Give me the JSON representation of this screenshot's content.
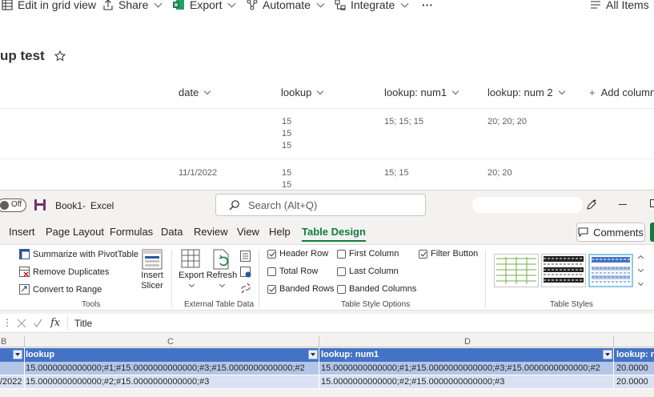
{
  "sharepoint": {
    "commands": [
      {
        "label": "Edit in grid view",
        "icon": "grid-icon"
      },
      {
        "label": "Share",
        "icon": "share-icon"
      },
      {
        "label": "Export",
        "icon": "excel-export-icon"
      },
      {
        "label": "Automate",
        "icon": "automate-icon"
      },
      {
        "label": "Integrate",
        "icon": "integrate-icon"
      }
    ],
    "more": "···",
    "view": "All Items",
    "list_title": "up test",
    "columns": [
      "date",
      "lookup",
      "lookup: num1",
      "lookup: num 2"
    ],
    "add_column": "Add column",
    "rows": [
      {
        "date": "",
        "lookup": [
          "15",
          "15",
          "15"
        ],
        "num1": "15; 15; 15",
        "num2": "20; 20; 20"
      },
      {
        "date": "11/1/2022",
        "lookup": [
          "15",
          "15"
        ],
        "num1": "15; 15",
        "num2": "20; 20"
      }
    ]
  },
  "excel": {
    "autosave": "Off",
    "doc_name": "Book1",
    "app_name": "Excel",
    "search_placeholder": "Search (Alt+Q)",
    "tabs": [
      "Insert",
      "Page Layout",
      "Formulas",
      "Data",
      "Review",
      "View",
      "Help",
      "Table Design"
    ],
    "active_tab": "Table Design",
    "comments": "Comments",
    "ribbon": {
      "tools": {
        "items": [
          "Summarize with PivotTable",
          "Remove Duplicates",
          "Convert to Range"
        ],
        "insert_slicer": "Insert Slicer",
        "label": "Tools"
      },
      "external": {
        "export": "Export",
        "refresh": "Refresh",
        "label": "External Table Data"
      },
      "style_options": {
        "items": [
          {
            "label": "Header Row",
            "checked": true
          },
          {
            "label": "Total Row",
            "checked": false
          },
          {
            "label": "Banded Rows",
            "checked": true
          },
          {
            "label": "First Column",
            "checked": false
          },
          {
            "label": "Last Column",
            "checked": false
          },
          {
            "label": "Banded Columns",
            "checked": false
          },
          {
            "label": "Filter Button",
            "checked": true
          }
        ],
        "label": "Table Style Options"
      },
      "table_styles": {
        "label": "Table Styles"
      }
    },
    "formula_bar": {
      "fx": "fx",
      "value": "Title"
    },
    "column_letters": [
      "B",
      "C",
      "D"
    ],
    "table_headers": [
      "lookup",
      "lookup: num1",
      "lookup: r"
    ],
    "rows": [
      {
        "a": "",
        "c": "15.0000000000000;#1;#15.0000000000000;#3;#15.0000000000000;#2",
        "d": "15.0000000000000;#1;#15.0000000000000;#3;#15.0000000000000;#2",
        "e": "20.0000"
      },
      {
        "a": "/2022",
        "c": "15.0000000000000;#2;#15.0000000000000;#3",
        "d": "15.0000000000000;#2;#15.0000000000000;#3",
        "e": "20.0000"
      }
    ],
    "colors": {
      "accent": "#107c41",
      "table_header": "#4472c4",
      "band_row": "#b4c6e7",
      "band_row_alt": "#d9e1f2"
    }
  }
}
